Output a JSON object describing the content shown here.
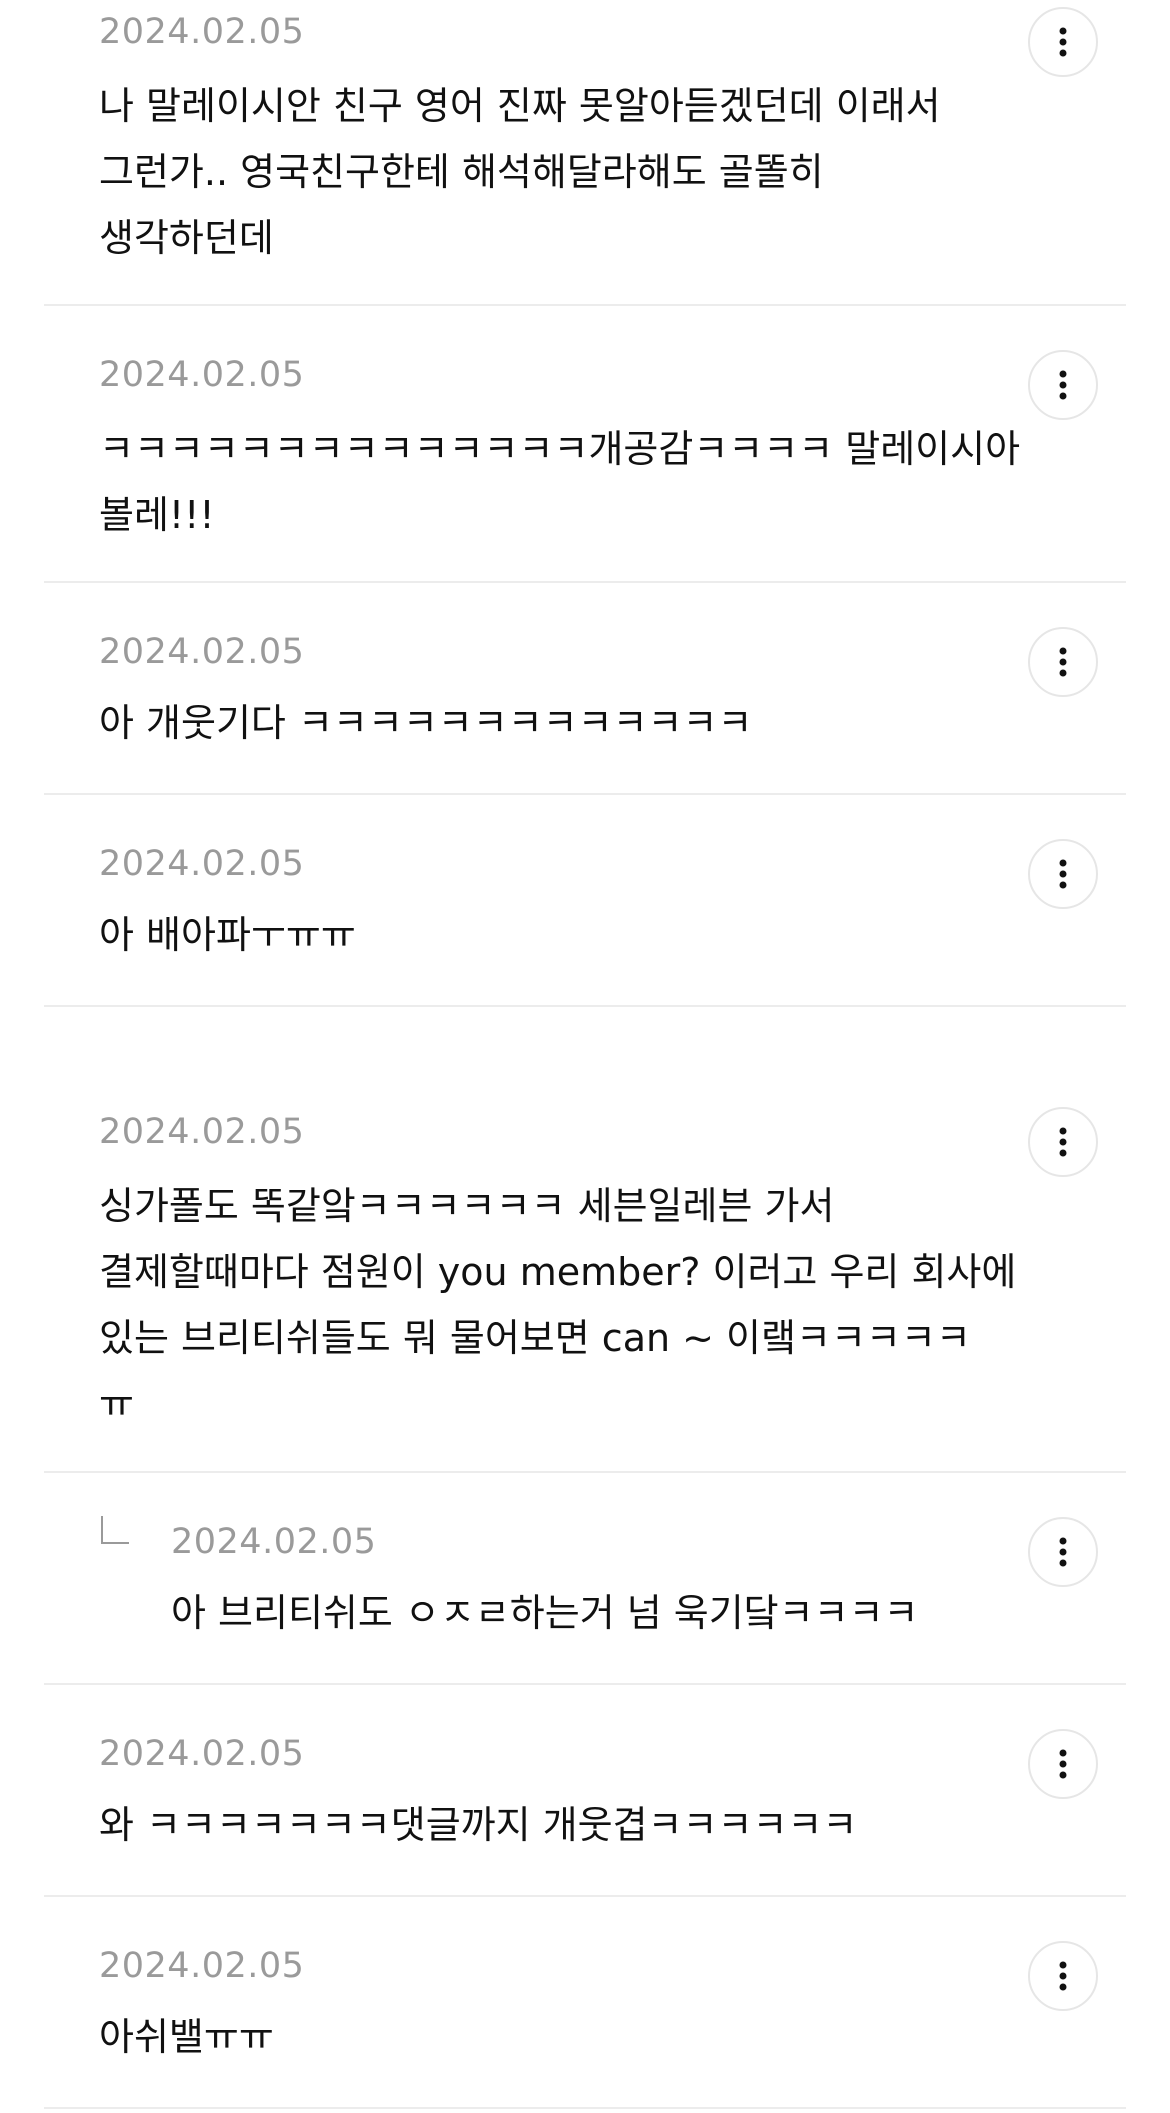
{
  "comments": [
    {
      "date": "2024.02.05",
      "text": "나 말레이시안 친구 영어 진짜 못알아듣겠던데 이래서\n그런가.. 영국친구한테 해석해달라해도 골똘히\n생각하던데"
    },
    {
      "date": "2024.02.05",
      "text": "ㅋㅋㅋㅋㅋㅋㅋㅋㅋㅋㅋㅋㅋㅋ개공감ㅋㅋㅋㅋ 말레이시아\n볼레!!!"
    },
    {
      "date": "2024.02.05",
      "text": "아 개웃기다 ㅋㅋㅋㅋㅋㅋㅋㅋㅋㅋㅋㅋㅋ"
    },
    {
      "date": "2024.02.05",
      "text": "아 배아파ㅜㅠㅠ"
    },
    {
      "date": "2024.02.05",
      "text": "싱가폴도 똑같앜ㅋㅋㅋㅋㅋㅋ 세븐일레븐 가서\n결제할때마다 점원이 you member? 이러고 우리 회사에\n있는 브리티쉬들도 뭐 물어보면 can ~ 이랰ㅋㅋㅋㅋㅋ\nㅠ"
    },
    {
      "date": "2024.02.05",
      "text": "아 브리티쉬도 ㅇㅈㄹ하는거 넘 욱기닼ㅋㅋㅋㅋ"
    },
    {
      "date": "2024.02.05",
      "text": "와 ㅋㅋㅋㅋㅋㅋㅋ댓글까지 개웃겹ㅋㅋㅋㅋㅋㅋ"
    },
    {
      "date": "2024.02.05",
      "text": "아쉬밸ㅠㅠ"
    }
  ],
  "icons": {
    "more": "more-vertical-icon",
    "reply": "reply-arrow-icon"
  },
  "colors": {
    "date": "#9a9a9a",
    "text": "#111111",
    "divider": "#ececec"
  }
}
